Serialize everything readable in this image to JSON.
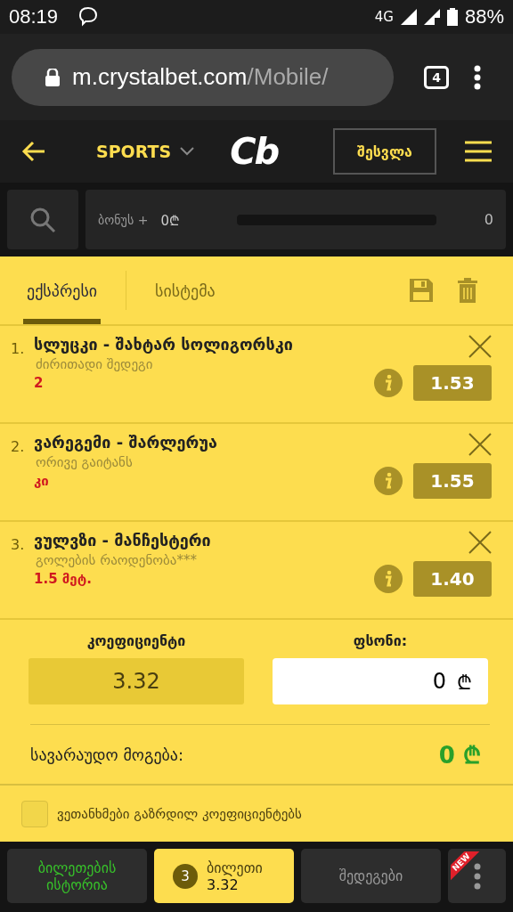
{
  "status_bar": {
    "time": "08:19",
    "network": "4G",
    "battery": "88%"
  },
  "browser": {
    "url_host": "m.crystalbet.com",
    "url_path": "/Mobile/",
    "tab_count": "4"
  },
  "header": {
    "menu": "SPORTS",
    "logo": "Cb",
    "login": "შესვლა"
  },
  "bonus": {
    "label": "ბონუს +",
    "amount": "0₾",
    "level": 0,
    "count": "0"
  },
  "tabs": [
    {
      "label": "ექსპრესი",
      "selected": true
    },
    {
      "label": "სისტემა",
      "selected": false
    }
  ],
  "bets": [
    {
      "number": "1.",
      "match": "სლუცკი - შახტარ სოლიგორსკი",
      "market": "ძირითადი შედეგი",
      "pick": "2",
      "odds": "1.53"
    },
    {
      "number": "2.",
      "match": "ვარეგემი - შარლერუა",
      "market": "ორივე გაიტანს",
      "pick": "კი",
      "odds": "1.55"
    },
    {
      "number": "3.",
      "match": "ვულვზი - მანჩესტერი",
      "market": "გოლების რაოდენობა***",
      "pick": "1.5 მეტ.",
      "odds": "1.40"
    }
  ],
  "summary": {
    "odds_label": "კოეფიციენტი",
    "odds_value": "3.32",
    "stake_label": "ფსონი:",
    "stake_value": "0",
    "currency": "₾",
    "win_label": "სავარაუდო მოგება:",
    "win_value": "0",
    "win_currency": "₾"
  },
  "agree": {
    "label": "ვეთანხმები გაზრდილ კოეფიციენტებს",
    "checked": false
  },
  "bottom_nav": [
    {
      "kind": "history",
      "label": "ბილეთების ისტორია",
      "selected": false
    },
    {
      "kind": "ticket",
      "label": "ბილეთი",
      "count": "3",
      "value": "3.32",
      "selected": true
    },
    {
      "kind": "results",
      "label": "შედეგები",
      "selected": false
    },
    {
      "kind": "more",
      "badge": "NEW",
      "selected": false
    }
  ]
}
